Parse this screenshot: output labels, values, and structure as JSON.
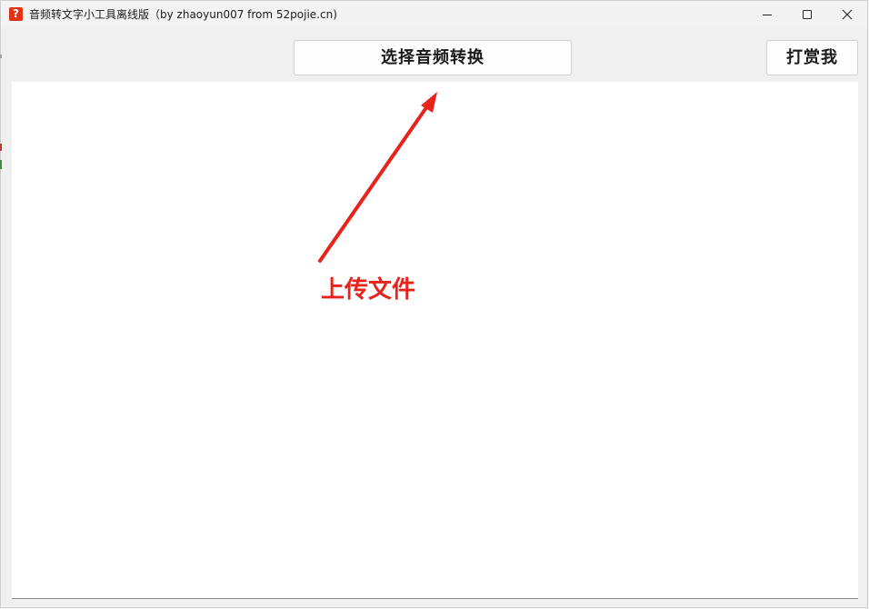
{
  "window": {
    "title": "音频转文字小工具离线版（by zhaoyun007 from 52pojie.cn)",
    "app_icon_glyph": "?",
    "icon_color": "#e53212"
  },
  "window_controls": {
    "minimize": "minimize-icon",
    "maximize": "maximize-icon",
    "close": "close-icon"
  },
  "toolbar": {
    "select_audio_label": "选择音频转换",
    "tip_label": "打赏我"
  },
  "transcript": {
    "text": ""
  },
  "annotation": {
    "label": "上传文件",
    "color": "#e8231a"
  }
}
